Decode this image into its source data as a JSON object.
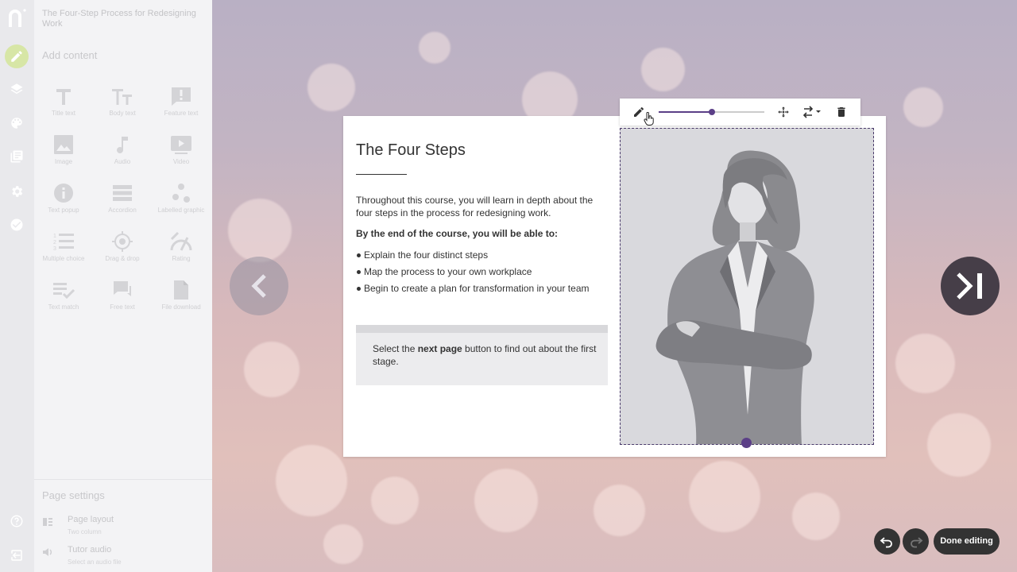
{
  "sidebar": {
    "course_title": "The Four-Step Process for Redesigning Work",
    "add_content_heading": "Add content",
    "tools": [
      {
        "label": "Title text",
        "icon": "title-text-icon"
      },
      {
        "label": "Body text",
        "icon": "body-text-icon"
      },
      {
        "label": "Feature text",
        "icon": "feature-text-icon"
      },
      {
        "label": "Image",
        "icon": "image-icon"
      },
      {
        "label": "Audio",
        "icon": "audio-icon"
      },
      {
        "label": "Video",
        "icon": "video-icon"
      },
      {
        "label": "Text popup",
        "icon": "info-icon"
      },
      {
        "label": "Accordion",
        "icon": "accordion-icon"
      },
      {
        "label": "Labelled graphic",
        "icon": "labelled-graphic-icon"
      },
      {
        "label": "Multiple choice",
        "icon": "multiple-choice-icon"
      },
      {
        "label": "Drag & drop",
        "icon": "target-icon"
      },
      {
        "label": "Rating",
        "icon": "rating-icon"
      },
      {
        "label": "Text match",
        "icon": "text-match-icon"
      },
      {
        "label": "Free text",
        "icon": "free-text-icon"
      },
      {
        "label": "File download",
        "icon": "file-icon"
      }
    ],
    "page_settings_heading": "Page settings",
    "page_layout": {
      "label": "Page layout",
      "value": "Two column"
    },
    "tutor_audio": {
      "label": "Tutor audio",
      "value": "Select an audio file"
    }
  },
  "rail": {
    "icons": [
      "logo-icon",
      "pencil-icon",
      "layers-icon",
      "palette-icon",
      "book-icon",
      "settings-icon",
      "check-circle-icon",
      "help-icon",
      "exit-icon"
    ]
  },
  "card": {
    "title": "The Four Steps",
    "intro": "Throughout this course, you will learn in depth about the four steps in the process for redesigning work.",
    "outcomes_heading": "By the end of the course, you will be able to:",
    "bullets": [
      "Explain the four distinct steps",
      "Map the process to your own workplace",
      "Begin to create a plan for transformation in your team"
    ],
    "callout_before": "Select the ",
    "callout_bold": "next page",
    "callout_after": " button to find out about the first stage."
  },
  "image_toolbar": {
    "zoom_fraction": 0.5,
    "icons": [
      "pencil-icon",
      "move-icon",
      "swap-icon",
      "delete-icon"
    ]
  },
  "controls": {
    "done_label": "Done editing"
  },
  "colors": {
    "accent": "#5b3f87",
    "dark": "#333333",
    "rail_active": "#d7e6a6"
  }
}
